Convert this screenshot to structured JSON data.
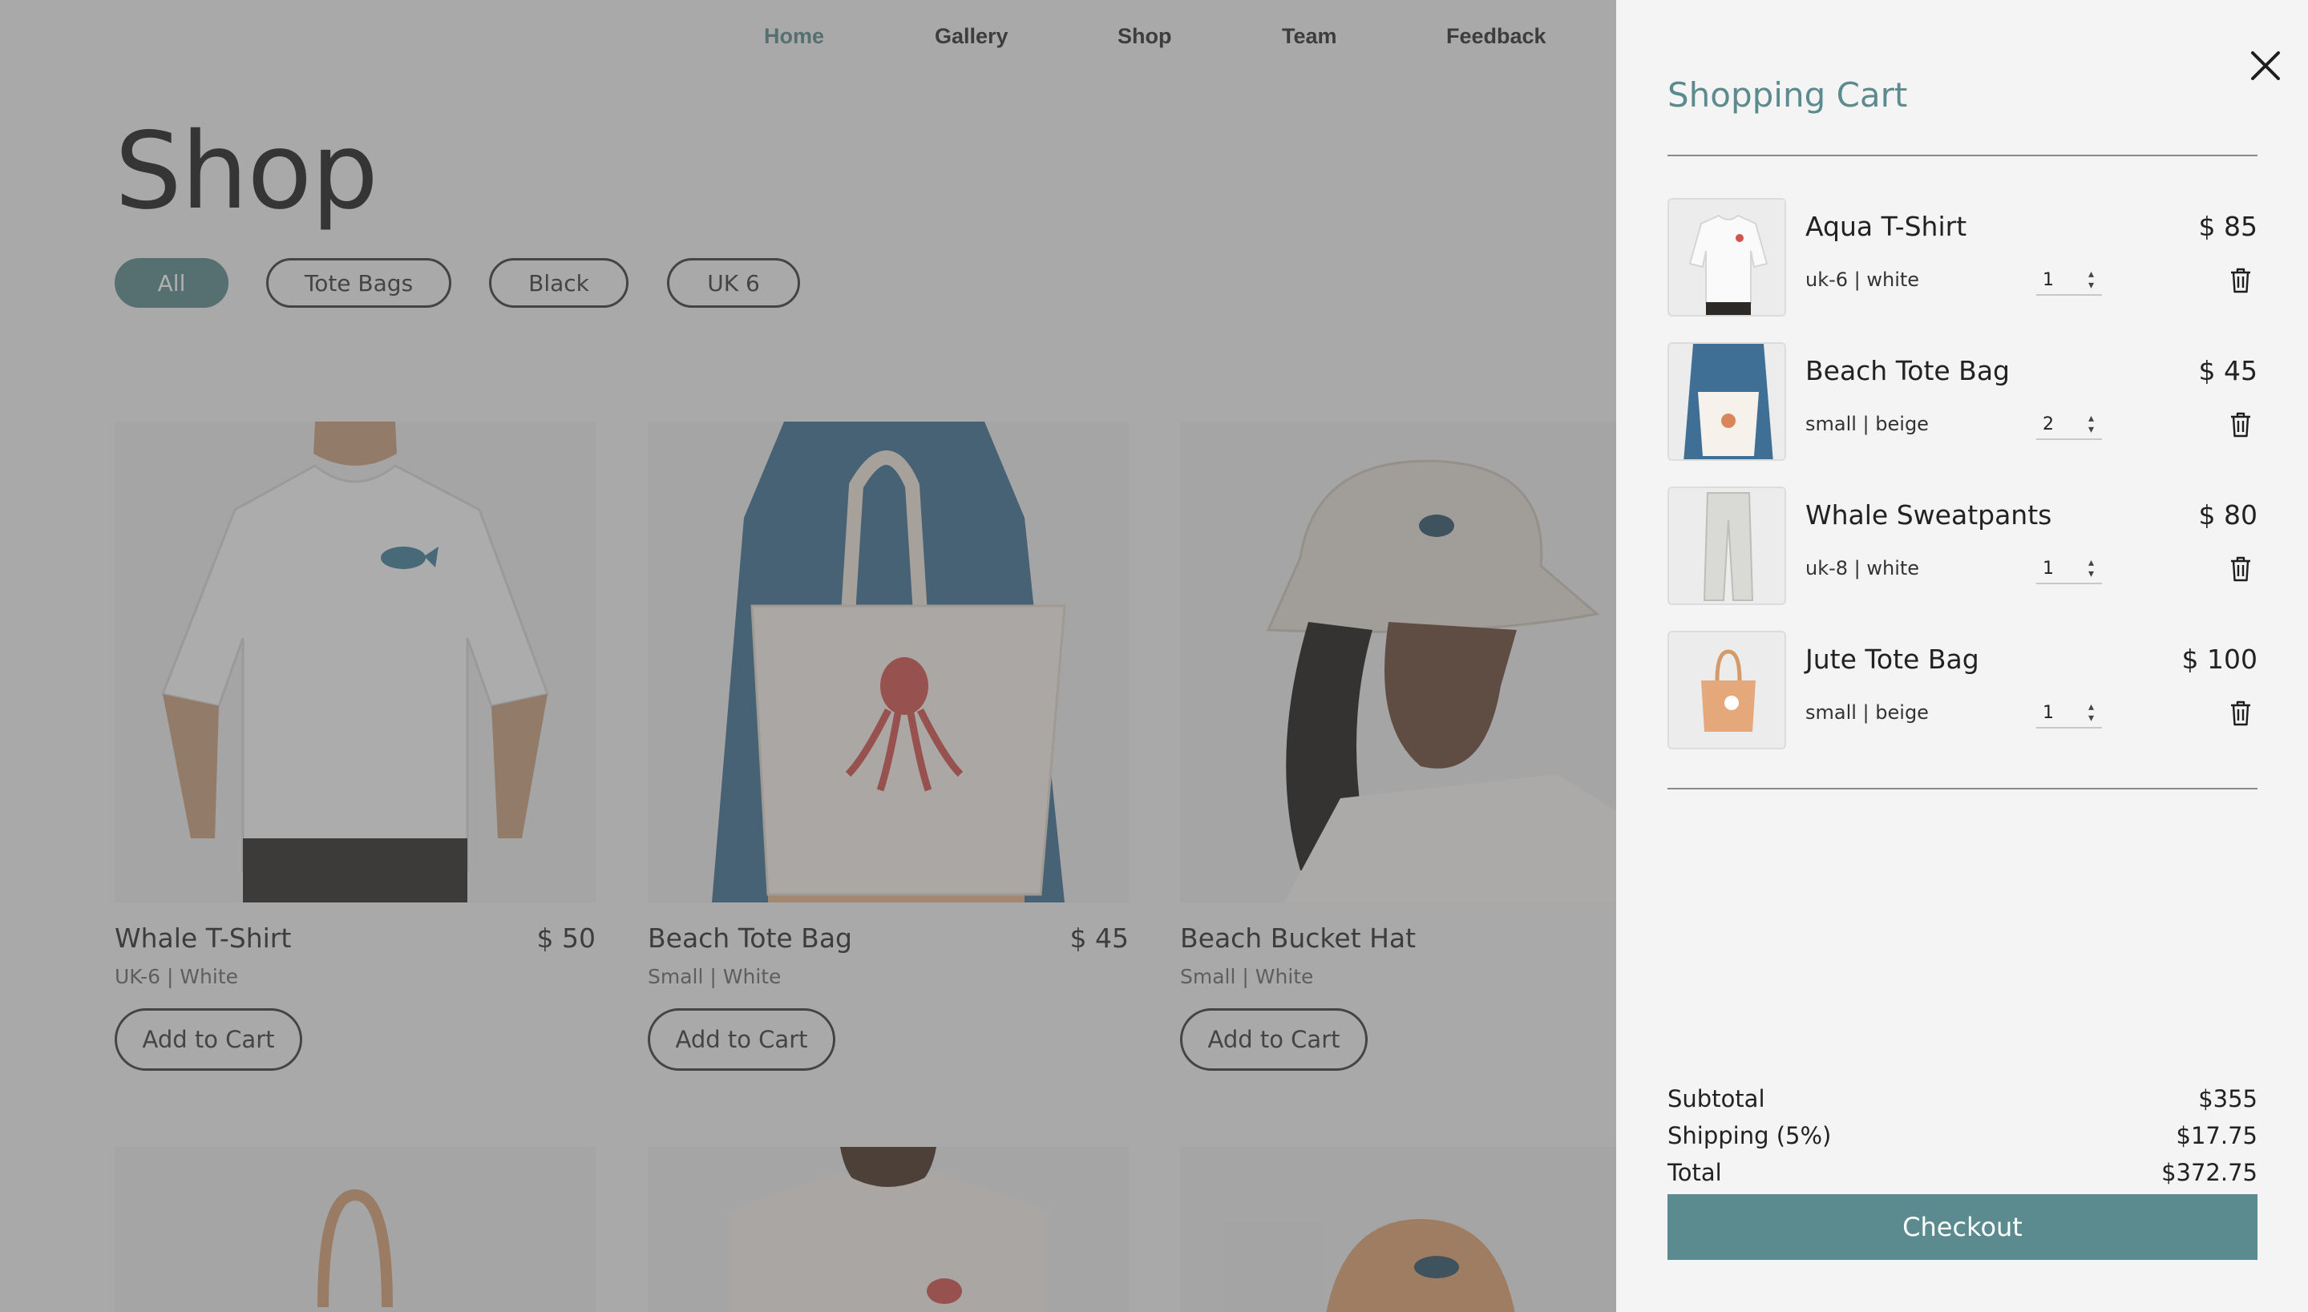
{
  "nav": {
    "items": [
      {
        "label": "Home",
        "active": true
      },
      {
        "label": "Gallery"
      },
      {
        "label": "Shop"
      },
      {
        "label": "Team"
      },
      {
        "label": "Feedback"
      }
    ]
  },
  "shop": {
    "title": "Shop",
    "filters": [
      "All",
      "Tote Bags",
      "Black",
      "UK 6"
    ],
    "products": [
      {
        "name": "Whale T-Shirt",
        "price": "$ 50",
        "variant": "UK-6 | White",
        "button": "Add to Cart"
      },
      {
        "name": "Beach Tote Bag",
        "price": "$ 45",
        "variant": "Small | White",
        "button": "Add to Cart"
      },
      {
        "name": "Beach Bucket Hat",
        "price": "$",
        "variant": "Small | White",
        "button": "Add to Cart"
      }
    ]
  },
  "cart": {
    "title": "Shopping Cart",
    "items": [
      {
        "name": "Aqua T-Shirt",
        "price": "$ 85",
        "variant": "uk-6 | white",
        "qty": "1"
      },
      {
        "name": "Beach Tote Bag",
        "price": "$ 45",
        "variant": "small | beige",
        "qty": "2"
      },
      {
        "name": "Whale Sweatpants",
        "price": "$ 80",
        "variant": "uk-8 | white",
        "qty": "1"
      },
      {
        "name": "Jute Tote Bag",
        "price": "$ 100",
        "variant": "small | beige",
        "qty": "1"
      }
    ],
    "summary": {
      "subtotal_label": "Subtotal",
      "subtotal": "$355",
      "shipping_label": "Shipping (5%)",
      "shipping": "$17.75",
      "total_label": "Total",
      "total": "$372.75"
    },
    "checkout_label": "Checkout"
  },
  "colors": {
    "accent": "#5b8b8e",
    "overlay": "rgba(80,80,80,0.46)",
    "background": "#f4f4f4"
  }
}
